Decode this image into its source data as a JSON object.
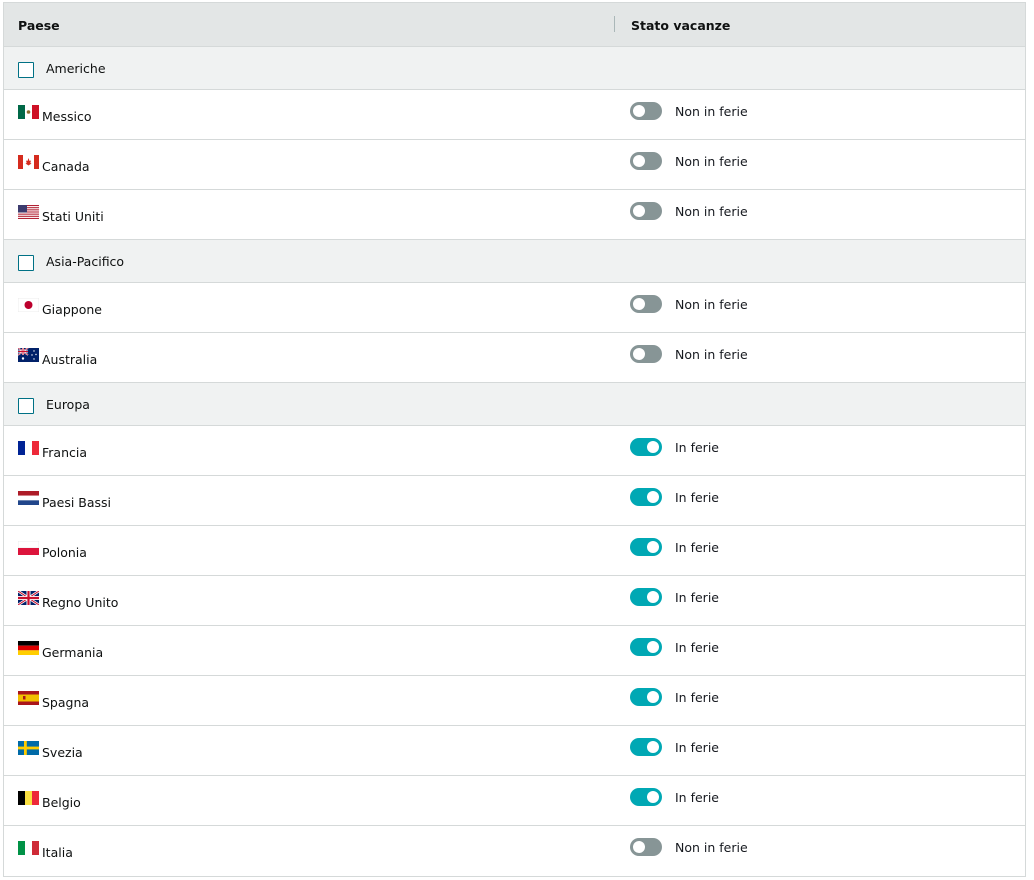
{
  "header": {
    "col_country": "Paese",
    "col_status": "Stato vacanze"
  },
  "colors": {
    "toggle_on": "#00a8b4",
    "toggle_off": "#879596",
    "header_bg": "#e3e6e6",
    "group_bg": "#f0f2f2"
  },
  "groups": [
    {
      "label": "Americhe",
      "checked": false,
      "countries": [
        {
          "name": "Messico",
          "flag": "mexico-flag",
          "on_vacation": false,
          "status": "Non in ferie"
        },
        {
          "name": "Canada",
          "flag": "canada-flag",
          "on_vacation": false,
          "status": "Non in ferie"
        },
        {
          "name": "Stati Uniti",
          "flag": "usa-flag",
          "on_vacation": false,
          "status": "Non in ferie"
        }
      ]
    },
    {
      "label": "Asia-Pacifico",
      "checked": false,
      "countries": [
        {
          "name": "Giappone",
          "flag": "japan-flag",
          "on_vacation": false,
          "status": "Non in ferie"
        },
        {
          "name": "Australia",
          "flag": "australia-flag",
          "on_vacation": false,
          "status": "Non in ferie"
        }
      ]
    },
    {
      "label": "Europa",
      "checked": false,
      "countries": [
        {
          "name": "Francia",
          "flag": "france-flag",
          "on_vacation": true,
          "status": "In ferie"
        },
        {
          "name": "Paesi Bassi",
          "flag": "netherlands-flag",
          "on_vacation": true,
          "status": "In ferie"
        },
        {
          "name": "Polonia",
          "flag": "poland-flag",
          "on_vacation": true,
          "status": "In ferie"
        },
        {
          "name": "Regno Unito",
          "flag": "uk-flag",
          "on_vacation": true,
          "status": "In ferie"
        },
        {
          "name": "Germania",
          "flag": "germany-flag",
          "on_vacation": true,
          "status": "In ferie"
        },
        {
          "name": "Spagna",
          "flag": "spain-flag",
          "on_vacation": true,
          "status": "In ferie"
        },
        {
          "name": "Svezia",
          "flag": "sweden-flag",
          "on_vacation": true,
          "status": "In ferie"
        },
        {
          "name": "Belgio",
          "flag": "belgium-flag",
          "on_vacation": true,
          "status": "In ferie"
        },
        {
          "name": "Italia",
          "flag": "italy-flag",
          "on_vacation": false,
          "status": "Non in ferie"
        }
      ]
    }
  ]
}
